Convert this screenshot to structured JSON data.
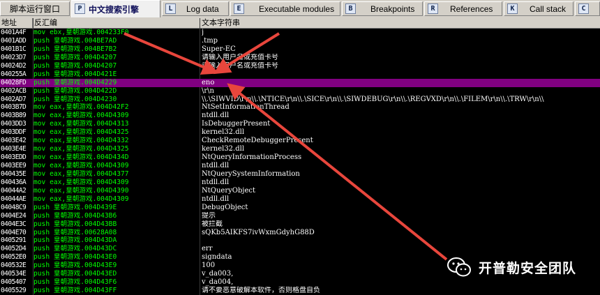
{
  "tabs": [
    {
      "icon": "",
      "label": "脚本运行窗口"
    },
    {
      "icon": "P",
      "label": "中文搜索引擎",
      "active": true
    },
    {
      "icon": "L",
      "label": "Log data"
    },
    {
      "icon": "E",
      "label": "Executable modules"
    },
    {
      "icon": "B",
      "label": "Breakpoints"
    },
    {
      "icon": "R",
      "label": "References"
    },
    {
      "icon": "K",
      "label": "Call stack"
    },
    {
      "icon": "C",
      "label": ""
    }
  ],
  "columns": [
    "地址",
    "反汇编",
    "文本字符串"
  ],
  "rows": [
    {
      "addr": "0401A4F",
      "ins": "mov ebx,皇朝游戏.004233F0",
      "text": "j"
    },
    {
      "addr": "0401ADD",
      "ins": "push 皇朝游戏.004BE7AD",
      "text": ".tmp"
    },
    {
      "addr": "0401B1C",
      "ins": "push 皇朝游戏.004BE7B2",
      "text": "Super-EC"
    },
    {
      "addr": "04023D7",
      "ins": "push 皇朝游戏.004D4207",
      "text": "请输入用户名或充值卡号"
    },
    {
      "addr": "04024D2",
      "ins": "push 皇朝游戏.004D4207",
      "text": "请输入用户名或充值卡号"
    },
    {
      "addr": "040255A",
      "ins": "push 皇朝游戏.004D421E",
      "text": ""
    },
    {
      "addr": "04028FD",
      "ins": "push 皇朝游戏.004D4229",
      "text": "eno"
    },
    {
      "addr": "0402ACB",
      "ins": "push 皇朝游戏.004D422D",
      "text": "\\r\\n"
    },
    {
      "addr": "0402AD7",
      "ins": "push 皇朝游戏.004D4230",
      "text": "\\\\.\\SIWVID\\r\\n\\\\.\\NTICE\\r\\n\\\\.\\SICE\\r\\n\\\\.\\SIWDEBUG\\r\\n\\\\.\\REGVXD\\r\\n\\\\.\\FILEM\\r\\n\\\\.\\TRW\\r\\n\\\\"
    },
    {
      "addr": "0403B7D",
      "ins": "mov eax,皇朝游戏.004D42F2",
      "text": "NtSetInformationThread"
    },
    {
      "addr": "0403B89",
      "ins": "mov eax,皇朝游戏.004D4309",
      "text": "ntdll.dll"
    },
    {
      "addr": "0403DD3",
      "ins": "mov eax,皇朝游戏.004D4313",
      "text": "IsDebuggerPresent"
    },
    {
      "addr": "0403DDF",
      "ins": "mov eax,皇朝游戏.004D4325",
      "text": "kernel32.dll"
    },
    {
      "addr": "0403E42",
      "ins": "mov eax,皇朝游戏.004D4332",
      "text": "CheckRemoteDebuggerPresent"
    },
    {
      "addr": "0403E4E",
      "ins": "mov eax,皇朝游戏.004D4325",
      "text": "kernel32.dll"
    },
    {
      "addr": "0403EDD",
      "ins": "mov eax,皇朝游戏.004D434D",
      "text": "NtQueryInformationProcess"
    },
    {
      "addr": "0403EE9",
      "ins": "mov eax,皇朝游戏.004D4309",
      "text": "ntdll.dll"
    },
    {
      "addr": "040435E",
      "ins": "mov eax,皇朝游戏.004D4377",
      "text": "NtQuerySystemInformation"
    },
    {
      "addr": "040436A",
      "ins": "mov eax,皇朝游戏.004D4309",
      "text": "ntdll.dll"
    },
    {
      "addr": "04044A2",
      "ins": "mov eax,皇朝游戏.004D4390",
      "text": "NtQueryObject"
    },
    {
      "addr": "04044AE",
      "ins": "mov eax,皇朝游戏.004D4309",
      "text": "ntdll.dll"
    },
    {
      "addr": "04048C9",
      "ins": "push 皇朝游戏.004D439E",
      "text": "DebugObject"
    },
    {
      "addr": "0404E24",
      "ins": "push 皇朝游戏.004D43B6",
      "text": "提示"
    },
    {
      "addr": "0404E3C",
      "ins": "push 皇朝游戏.004D43BB",
      "text": "被拦截"
    },
    {
      "addr": "0404E70",
      "ins": "push 皇朝游戏.00628A08",
      "text": "sQKb5AIKFS7ivWxmGdyhG88D"
    },
    {
      "addr": "0405291",
      "ins": "push 皇朝游戏.004D43DA",
      "text": ""
    },
    {
      "addr": "04052D4",
      "ins": "push 皇朝游戏.004D43DC",
      "text": "err"
    },
    {
      "addr": "04052E0",
      "ins": "push 皇朝游戏.004D43E0",
      "text": "signdata"
    },
    {
      "addr": "040532E",
      "ins": "push 皇朝游戏.004D43E9",
      "text": "100"
    },
    {
      "addr": "040534E",
      "ins": "push 皇朝游戏.004D43ED",
      "text": "v_da003,"
    },
    {
      "addr": "0405407",
      "ins": "push 皇朝游戏.004D43F6",
      "text": "v_da004,"
    },
    {
      "addr": "0405529",
      "ins": "push 皇朝游戏.004D43FF",
      "text": "请不要恶意破解本软件，否则格盘自负"
    }
  ],
  "selected_row": 6,
  "watermark": {
    "text": "开普勒安全团队",
    "icon": "wechat-icon"
  },
  "colors": {
    "background": "#000000",
    "address_text": "#ffffff",
    "instruction_text": "#00ff00",
    "selection": "#800080",
    "arrow": "#e8463c"
  }
}
